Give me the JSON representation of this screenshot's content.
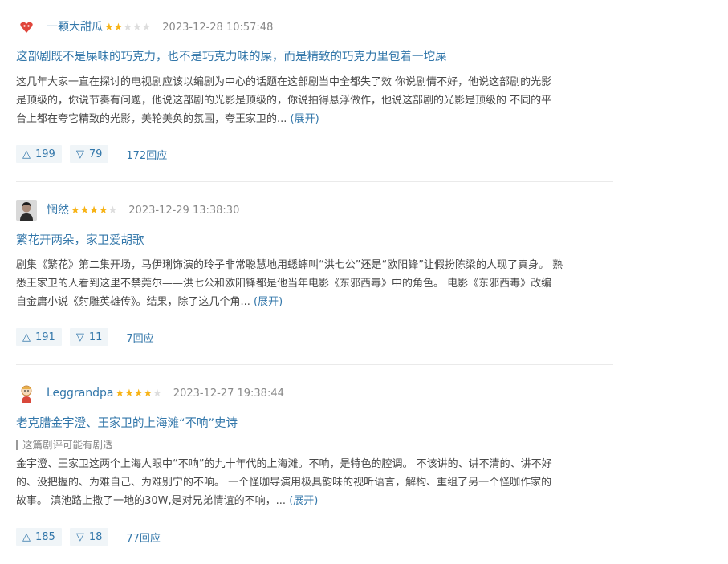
{
  "reviews": [
    {
      "author": "一颗大甜瓜",
      "rating": 2,
      "time": "2023-12-28 10:57:48",
      "title": "这部剧既不是屎味的巧克力，也不是巧克力味的屎，而是精致的巧克力里包着一坨屎",
      "body_lines": [
        "这几年大家一直在探讨的电视剧应该以编剧为中心的话题在这部剧当中全都失了效 你说剧情不好，他说这部剧的光影",
        "是顶级的，你说节奏有问题，他说这部剧的光影是顶级的，你说拍得悬浮做作，他说这部剧的光影是顶级的 不同的平",
        "台上都在夸它精致的光影，美轮美奂的氛围，夸王家卫的..."
      ],
      "expand_label": "(展开)",
      "up": "199",
      "down": "79",
      "replies": "172回应"
    },
    {
      "author": "惘然",
      "rating": 4,
      "time": "2023-12-29 13:38:30",
      "title": "繁花开两朵，家卫爱胡歌",
      "body_lines": [
        "剧集《繁花》第二集开场，马伊琍饰演的玲子非常聪慧地用蟋蟀叫“洪七公”还是“欧阳锋”让假扮陈梁的人现了真身。 熟",
        "悉王家卫的人看到这里不禁莞尔——洪七公和欧阳锋都是他当年电影《东邪西毒》中的角色。 电影《东邪西毒》改编",
        "自金庸小说《射雕英雄传》。结果，除了这几个角..."
      ],
      "expand_label": "(展开)",
      "up": "191",
      "down": "11",
      "replies": "7回应"
    },
    {
      "author": "Leggrandpa",
      "rating": 4,
      "time": "2023-12-27 19:38:44",
      "title": "老克腊金宇澄、王家卫的上海滩“不响”史诗",
      "spoiler": "这篇剧评可能有剧透",
      "body_lines": [
        "金宇澄、王家卫这两个上海人眼中“不响”的九十年代的上海滩。不响，是特色的腔调。 不该讲的、讲不清的、讲不好",
        "的、没把握的、为难自己、为难别宁的不响。 一个怪咖导演用极具韵味的视听语言，解构、重组了另一个怪咖作家的",
        "故事。 滇池路上撒了一地的30W,是对兄弟情谊的不响，..."
      ],
      "expand_label": "(展开)",
      "up": "185",
      "down": "18",
      "replies": "77回应"
    }
  ],
  "colors": {
    "link": "#3377aa",
    "star": "#f7b316",
    "vote_bg": "#f0f5f8"
  },
  "icons": {
    "up": "triangle-up-icon",
    "down": "triangle-down-icon"
  }
}
